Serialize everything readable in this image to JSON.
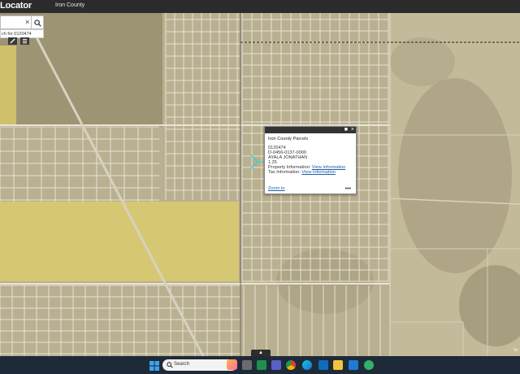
{
  "app": {
    "title": "Locator",
    "subtitle": "Iron County"
  },
  "search": {
    "value": "",
    "clear_glyph": "×",
    "suggestion": "ch for 0120474",
    "search_icon": "search-icon"
  },
  "tools": [
    {
      "icon": "draw-icon"
    },
    {
      "icon": "list-icon"
    }
  ],
  "popup": {
    "header": "Iron County Parcels",
    "parcel_id": "0120474",
    "account": "D-0456-0137-0000",
    "owner": "AYALA JONATHAN",
    "acres": "1.25",
    "property_label": "Property Information: ",
    "property_link": "View Information",
    "tax_label": "Tax Information: ",
    "tax_link": "View Information",
    "zoom_label": "Zoom to",
    "more_glyph": "•••",
    "min_glyph": "■",
    "close_glyph": "×"
  },
  "map": {
    "handle_glyph": "▲",
    "attribution": "Sc",
    "colors": {
      "parcel_fill": "#e0d06a",
      "roads": "#e7e2d2",
      "boundary": "#222222"
    }
  },
  "taskbar": {
    "search_label": "Search",
    "icons": [
      "windows-icon",
      "search-icon",
      "copilot-icon",
      "excel-icon",
      "teams-icon",
      "chrome-icon",
      "edge-icon",
      "outlook-icon",
      "file-explorer-icon",
      "mail-icon",
      "store-icon"
    ]
  }
}
